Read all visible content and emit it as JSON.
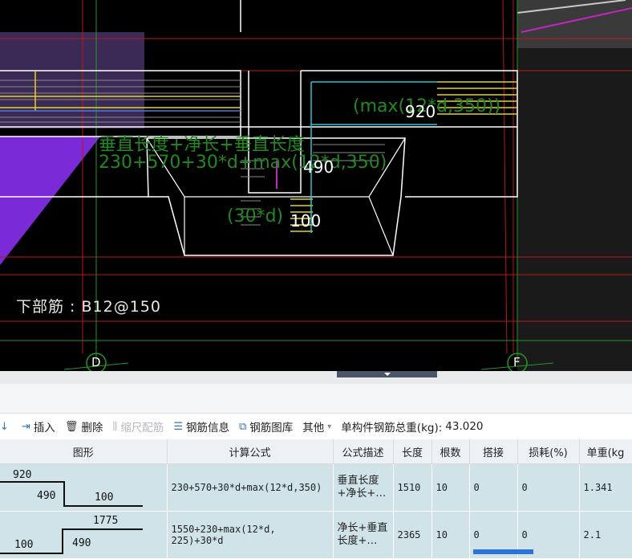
{
  "cad": {
    "dim_top": "(max(12*d,350))",
    "dim_top_num": "920",
    "dim_mid_label": "垂直长度+净长+垂直长度",
    "dim_mid_formula": "230+570+30*d+max(12*d,350)",
    "dim_mid_num": "490",
    "dim_bottom": "(30*d)",
    "dim_bottom_num": "100",
    "rebar_note": "下部筋   : B12@150",
    "axis_left": "D",
    "axis_right": "F"
  },
  "toolbar": {
    "insert": "插入",
    "delete": "删除",
    "scale_rebar": "缩尺配筋",
    "rebar_info": "钢筋信息",
    "rebar_library": "钢筋图库",
    "other": "其他",
    "total_weight_label": "单构件钢筋总重(kg):",
    "total_weight_value": "43.020"
  },
  "table": {
    "headers": [
      "图形",
      "计算公式",
      "公式描述",
      "长度",
      "根数",
      "搭接",
      "损耗(%)",
      "单重(kg"
    ],
    "rows": [
      {
        "shape": {
          "top": "920",
          "left": "490",
          "right": "100"
        },
        "formula": "230+570+30*d+max(12*d,350)",
        "desc": "垂直长度\n+净长+…",
        "length": "1510",
        "count": "10",
        "overlap": "0",
        "loss": "0",
        "unit_weight": "1.341"
      },
      {
        "shape": {
          "top": "1775",
          "left": "100",
          "right": "490"
        },
        "formula": "1550+230+max(12*d,\n225)+30*d",
        "desc": "净长+垂直\n长度+…",
        "length": "2365",
        "count": "10",
        "overlap": "0",
        "loss": "0",
        "unit_weight": "2.1"
      }
    ]
  },
  "colors": {
    "cad_background": "#000000",
    "table_row": "#cfe3e8",
    "accent": "#2d6fd6"
  }
}
